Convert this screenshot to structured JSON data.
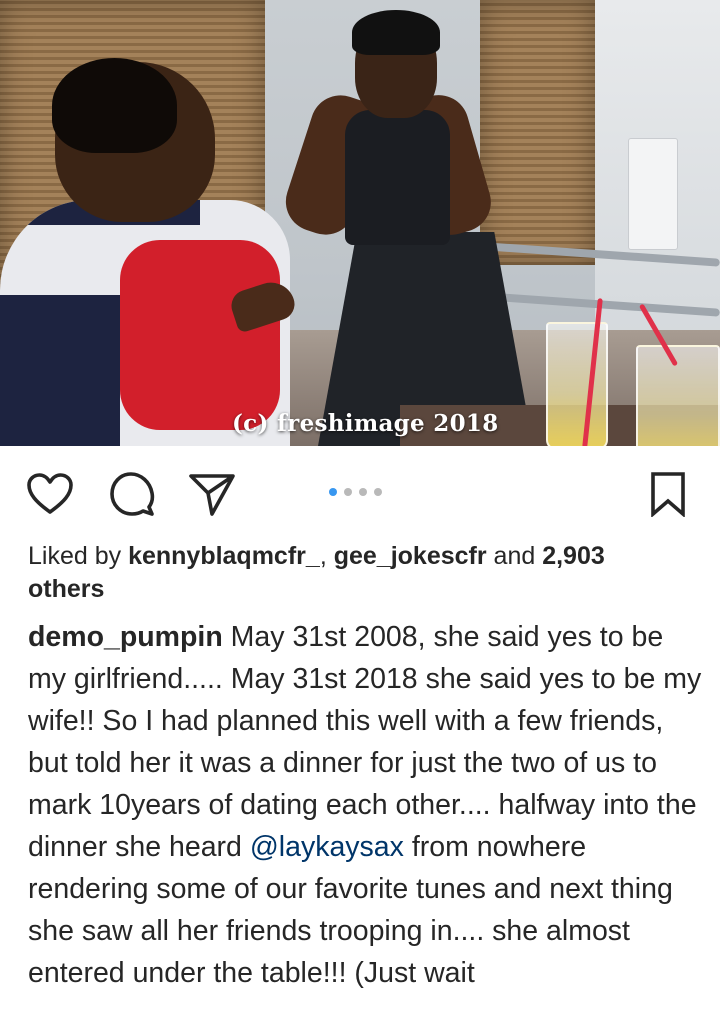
{
  "post": {
    "watermark": "(c) freshimage 2018"
  },
  "actions": {
    "like_icon": "heart-outline-icon",
    "comment_icon": "comment-bubble-icon",
    "share_icon": "paper-plane-icon",
    "save_icon": "bookmark-outline-icon",
    "carousel": {
      "total": 4,
      "active_index": 0
    },
    "accent_color": "#3897f0"
  },
  "likes": {
    "prefix": "Liked by ",
    "user1": "kennyblaqmcfr_",
    "separator": ", ",
    "user2": "gee_jokescfr",
    "and_text": " and ",
    "count": "2,903",
    "suffix": "others"
  },
  "caption": {
    "username": "demo_pumpin",
    "text_part1": " May 31st 2008, she said yes to be my girlfriend..... May 31st 2018 she said yes to be my wife!! So I had planned this well with a few friends, but told her it was a dinner for just the two of us to mark 10years of dating each other.... halfway into the dinner she heard ",
    "mention": "@laykaysax",
    "text_part2": " from nowhere rendering some of our favorite tunes and next thing she saw all her friends trooping in.... she almost entered under the table!!! (Just wait"
  }
}
